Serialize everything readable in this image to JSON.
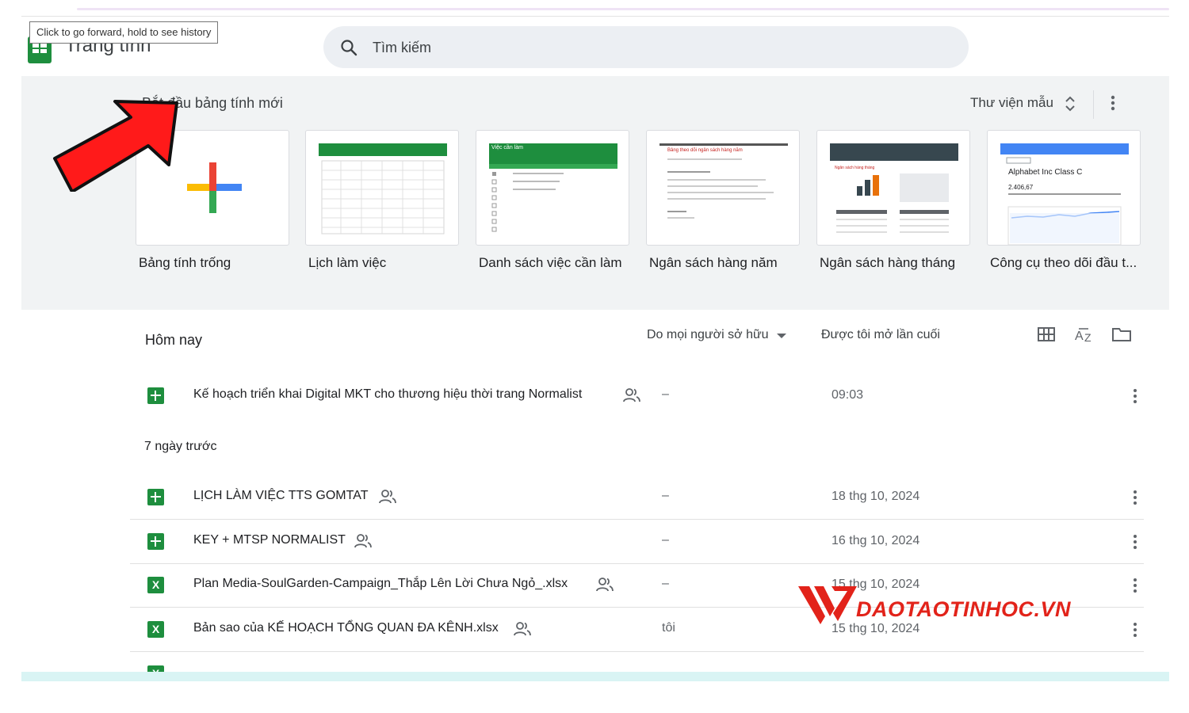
{
  "browser": {
    "tooltip": "Click to go forward, hold to see history"
  },
  "header": {
    "app_title": "Trang tính",
    "search_placeholder": "Tìm kiếm"
  },
  "templates": {
    "heading": "Bắt đầu bảng tính mới",
    "gallery_label": "Thư viện mẫu",
    "cards": [
      {
        "label": "Bảng tính trống"
      },
      {
        "label": "Lịch làm việc"
      },
      {
        "label": "Danh sách việc cần làm"
      },
      {
        "label": "Ngân sách hàng năm"
      },
      {
        "label": "Ngân sách hàng tháng"
      },
      {
        "label": "Công cụ theo dõi đầu t..."
      }
    ],
    "thumb_text": {
      "todo_title": "Việc cần làm",
      "annual_title": "Bảng theo dõi ngân sách hàng năm",
      "monthly_title": "Ngân sách hàng tháng",
      "stock_name": "Alphabet Inc Class C",
      "stock_price": "2.406,67"
    }
  },
  "files": {
    "section_today": "Hôm nay",
    "owner_filter": "Do mọi người sở hữu",
    "last_opened": "Được tôi mở lần cuối",
    "section_week": "7 ngày trước",
    "today_rows": [
      {
        "type": "sheet",
        "name": "Kế hoạch triển khai Digital MKT cho thương hiệu thời trang Normalist",
        "owner": "–",
        "date": "09:03"
      }
    ],
    "week_rows": [
      {
        "type": "sheet",
        "name": "LỊCH LÀM VIỆC TTS GOMTAT",
        "owner": "–",
        "date": "18 thg 10, 2024"
      },
      {
        "type": "sheet",
        "name": "KEY + MTSP NORMALIST",
        "owner": "–",
        "date": "16 thg 10, 2024"
      },
      {
        "type": "xls",
        "name": "Plan Media-SoulGarden-Campaign_Thắp Lên Lời Chưa Ngỏ_.xlsx",
        "owner": "–",
        "date": "15 thg 10, 2024"
      },
      {
        "type": "xls",
        "name": "Bản sao của KẾ HOẠCH TỔNG QUAN ĐA KÊNH.xlsx",
        "owner": "tôi",
        "date": "15 thg 10, 2024"
      }
    ],
    "xls_icon_letter": "X"
  },
  "watermark": {
    "text": "DAOTAOTINHOC.VN"
  },
  "colors": {
    "accent_green": "#1e8e3e",
    "watermark_red": "#e2231a",
    "arrow_red": "#ff1a1a"
  }
}
